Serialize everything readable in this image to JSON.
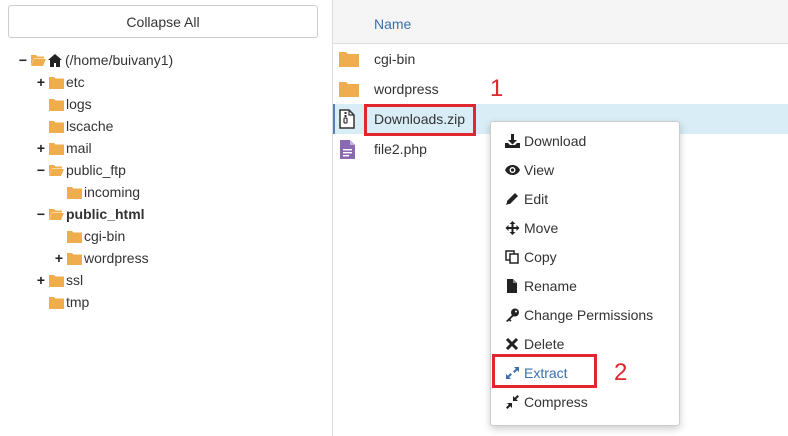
{
  "left_panel": {
    "collapse_label": "Collapse All",
    "tree": [
      {
        "toggle": "−",
        "label": "(/home/buivany1)",
        "bold": false
      },
      {
        "toggle": "+",
        "label": "etc",
        "bold": false
      },
      {
        "toggle": "",
        "label": "logs",
        "bold": false
      },
      {
        "toggle": "",
        "label": "lscache",
        "bold": false
      },
      {
        "toggle": "+",
        "label": "mail",
        "bold": false
      },
      {
        "toggle": "−",
        "label": "public_ftp",
        "bold": false
      },
      {
        "toggle": "",
        "label": "incoming",
        "bold": false
      },
      {
        "toggle": "−",
        "label": "public_html",
        "bold": true
      },
      {
        "toggle": "",
        "label": "cgi-bin",
        "bold": false
      },
      {
        "toggle": "+",
        "label": "wordpress",
        "bold": false
      },
      {
        "toggle": "+",
        "label": "ssl",
        "bold": false
      },
      {
        "toggle": "",
        "label": "tmp",
        "bold": false
      }
    ]
  },
  "file_list": {
    "column_name": "Name",
    "files": [
      {
        "name": "cgi-bin",
        "icon": "folder-icon"
      },
      {
        "name": "wordpress",
        "icon": "folder-icon"
      },
      {
        "name": "Downloads.zip",
        "icon": "zip-file-icon",
        "selected": true
      },
      {
        "name": "file2.php",
        "icon": "php-file-icon"
      }
    ]
  },
  "context_menu": {
    "items": [
      {
        "label": "Download",
        "icon": "download-icon"
      },
      {
        "label": "View",
        "icon": "eye-icon"
      },
      {
        "label": "Edit",
        "icon": "pencil-icon"
      },
      {
        "label": "Move",
        "icon": "move-arrows-icon"
      },
      {
        "label": "Copy",
        "icon": "copy-icon"
      },
      {
        "label": "Rename",
        "icon": "file-icon"
      },
      {
        "label": "Change Permissions",
        "icon": "key-icon"
      },
      {
        "label": "Delete",
        "icon": "x-icon"
      },
      {
        "label": "Extract",
        "icon": "expand-icon"
      },
      {
        "label": "Compress",
        "icon": "compress-icon"
      }
    ]
  },
  "annotations": {
    "step1": "1",
    "step2": "2"
  },
  "colors": {
    "folder": "#f0ad4e",
    "link_blue": "#3a6fb0",
    "selected_row": "#d9edf7",
    "annotation_red": "#e0262e",
    "php_icon": "#8a6bb3"
  }
}
